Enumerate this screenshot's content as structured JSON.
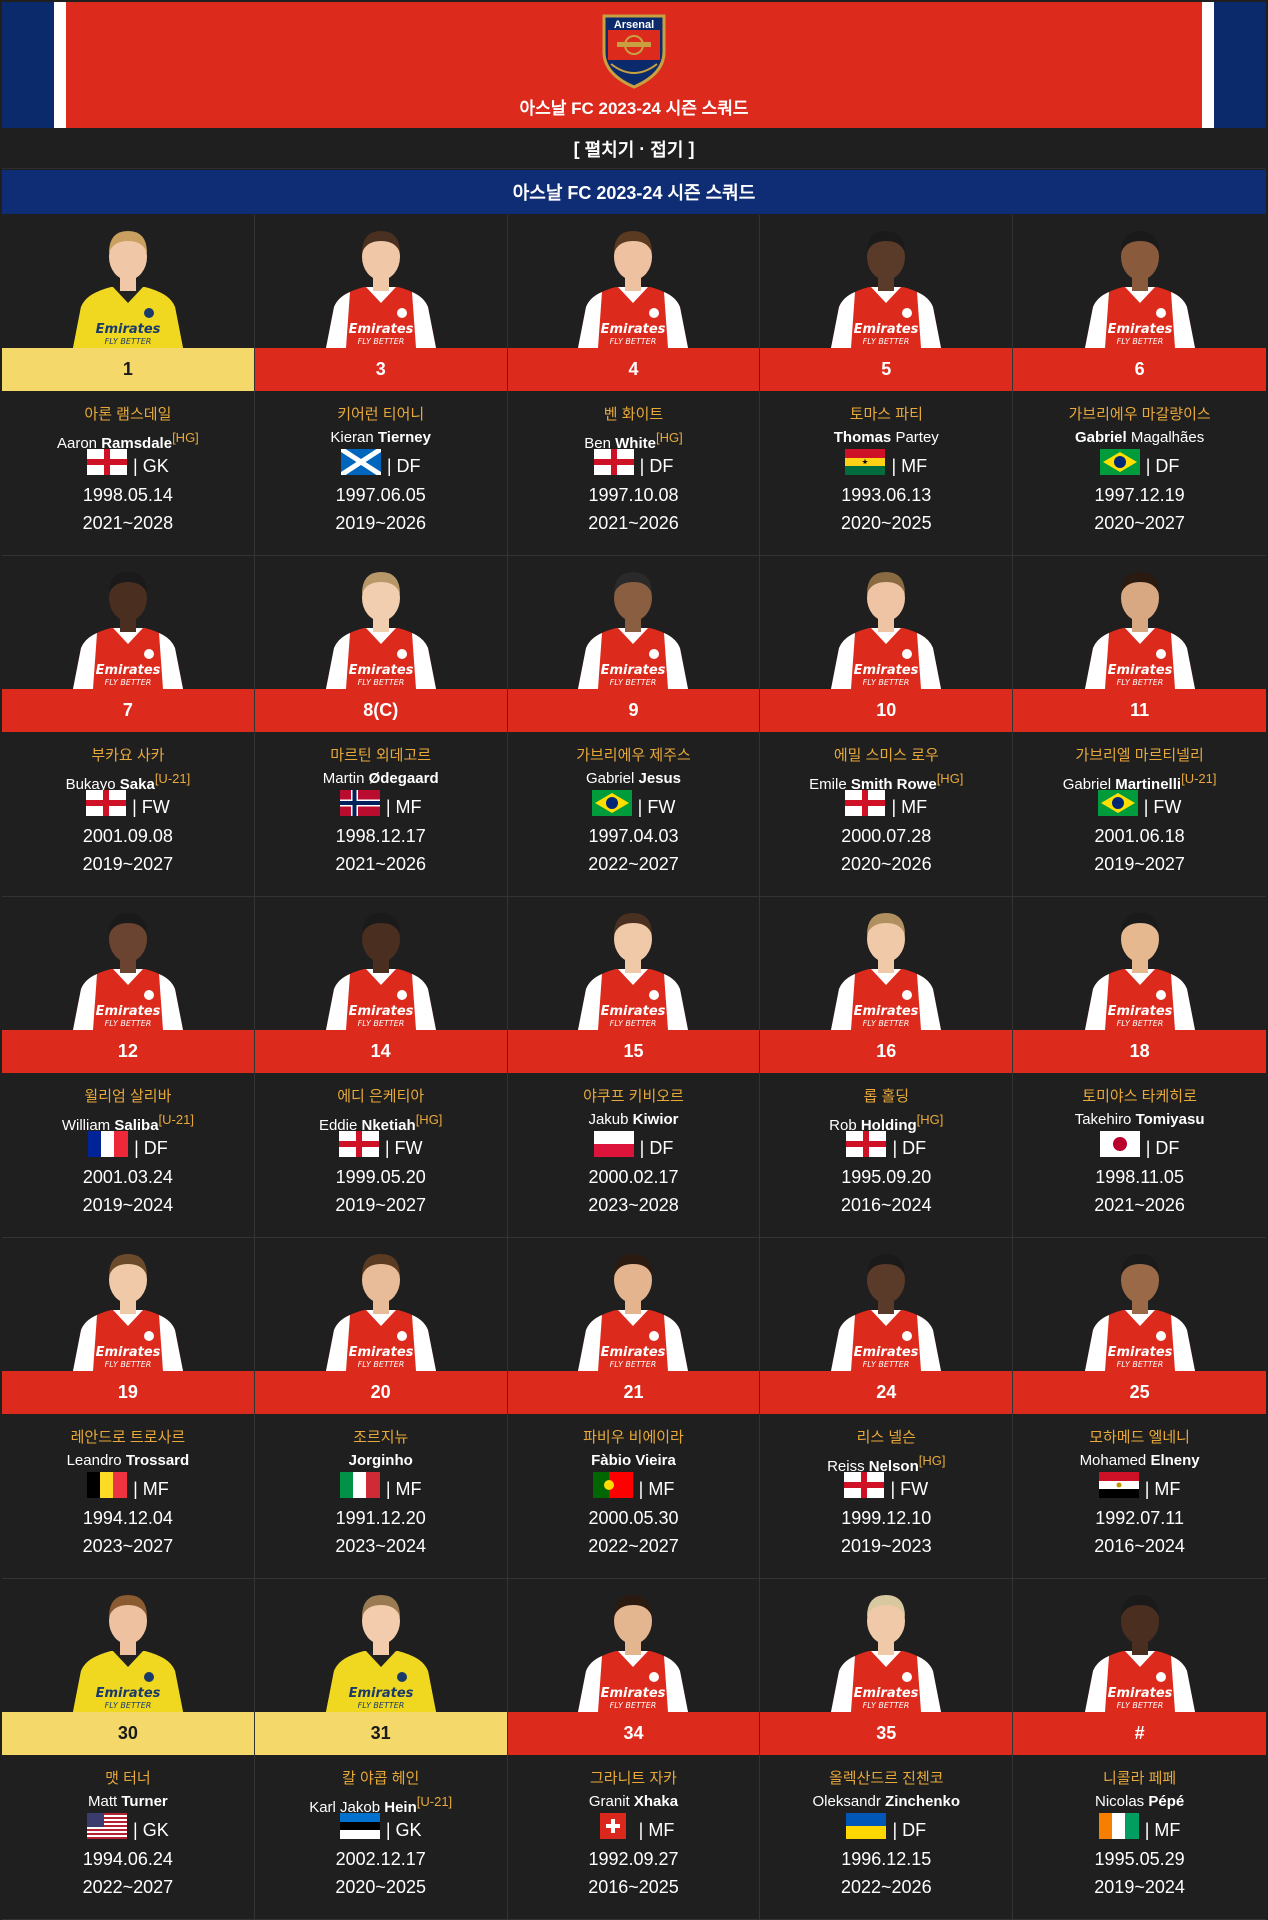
{
  "header": {
    "title": "아스날 FC 2023-24 시즌 스쿼드",
    "crest_text": "Arsenal"
  },
  "toggle": {
    "open_bracket": "[",
    "expand": "펼치기",
    "sep": "·",
    "collapse": "접기",
    "close_bracket": "]"
  },
  "section_title": "아스날 FC 2023-24 시즌 스쿼드",
  "colors": {
    "red": "#dc2a1c",
    "navy": "#0e2d75",
    "gold": "#e8a93a",
    "gk_bg": "#f4d96a",
    "bg": "#1f1f1f"
  },
  "players": [
    {
      "number": "1",
      "gk": true,
      "kname": "아론 램스데일",
      "first": "Aaron ",
      "last": "Ramsdale",
      "suffix": "[HG]",
      "flag": "england",
      "pos": "| GK",
      "dob": "1998.05.14",
      "contract": "2021~2028",
      "skin": "#f0c8a8",
      "hair": "#c9a060"
    },
    {
      "number": "3",
      "gk": false,
      "kname": "키어런 티어니",
      "first": "Kieran ",
      "last": "Tierney",
      "suffix": "",
      "flag": "scotland",
      "pos": "| DF",
      "dob": "1997.06.05",
      "contract": "2019~2026",
      "skin": "#f0c8a8",
      "hair": "#4a3020"
    },
    {
      "number": "4",
      "gk": false,
      "kname": "벤 화이트",
      "first": "Ben ",
      "last": "White",
      "suffix": "[HG]",
      "flag": "england",
      "pos": "| DF",
      "dob": "1997.10.08",
      "contract": "2021~2026",
      "skin": "#eec2a0",
      "hair": "#5a3a20"
    },
    {
      "number": "5",
      "gk": false,
      "kname": "토마스 파티",
      "first": "Thomas",
      "last": " Partey",
      "suffix": "",
      "boldfirst": true,
      "flag": "ghana",
      "pos": "| MF",
      "dob": "1993.06.13",
      "contract": "2020~2025",
      "skin": "#5a3a28",
      "hair": "#1a1a1a"
    },
    {
      "number": "6",
      "gk": false,
      "kname": "가브리에우 마갈량이스",
      "first": "Gabriel",
      "last": " Magalhães",
      "suffix": "",
      "boldfirst": true,
      "flag": "brazil",
      "pos": "| DF",
      "dob": "1997.12.19",
      "contract": "2020~2027",
      "skin": "#8a5a3c",
      "hair": "#1a1a1a"
    },
    {
      "number": "7",
      "gk": false,
      "kname": "부카요 사카",
      "first": "Bukayo ",
      "last": "Saka",
      "suffix": "[U-21]",
      "flag": "england",
      "pos": "| FW",
      "dob": "2001.09.08",
      "contract": "2019~2027",
      "skin": "#4a2e20",
      "hair": "#1a1a1a"
    },
    {
      "number": "8(C)",
      "gk": false,
      "kname": "마르틴 외데고르",
      "first": "Martin ",
      "last": "Ødegaard",
      "suffix": "",
      "flag": "norway",
      "pos": "| MF",
      "dob": "1998.12.17",
      "contract": "2021~2026",
      "skin": "#f2ceb0",
      "hair": "#b89868"
    },
    {
      "number": "9",
      "gk": false,
      "kname": "가브리에우 제주스",
      "first": "Gabriel ",
      "last": "Jesus",
      "suffix": "",
      "flag": "brazil",
      "pos": "| FW",
      "dob": "1997.04.03",
      "contract": "2022~2027",
      "skin": "#8a5e40",
      "hair": "#2a2a2a"
    },
    {
      "number": "10",
      "gk": false,
      "kname": "에밀 스미스 로우",
      "first": "Emile ",
      "last": "Smith Rowe",
      "suffix": "[HG]",
      "flag": "england",
      "pos": "| MF",
      "dob": "2000.07.28",
      "contract": "2020~2026",
      "skin": "#eec4a4",
      "hair": "#8a6a40"
    },
    {
      "number": "11",
      "gk": false,
      "kname": "가브리엘 마르티넬리",
      "first": "Gabriel ",
      "last": "Martinelli",
      "suffix": "[U-21]",
      "flag": "brazil",
      "pos": "| FW",
      "dob": "2001.06.18",
      "contract": "2019~2027",
      "skin": "#d8a882",
      "hair": "#2a1a10"
    },
    {
      "number": "12",
      "gk": false,
      "kname": "윌리엄 살리바",
      "first": "William ",
      "last": "Saliba",
      "suffix": "[U-21]",
      "flag": "france",
      "pos": "| DF",
      "dob": "2001.03.24",
      "contract": "2019~2024",
      "skin": "#6a4430",
      "hair": "#1a1a1a"
    },
    {
      "number": "14",
      "gk": false,
      "kname": "에디 은케티아",
      "first": "Eddie ",
      "last": "Nketiah",
      "suffix": "[HG]",
      "flag": "england",
      "pos": "| FW",
      "dob": "1999.05.20",
      "contract": "2019~2027",
      "skin": "#4a2e20",
      "hair": "#1a1a1a"
    },
    {
      "number": "15",
      "gk": false,
      "kname": "야쿠프 키비오르",
      "first": "Jakub ",
      "last": "Kiwior",
      "suffix": "",
      "flag": "poland",
      "pos": "| DF",
      "dob": "2000.02.17",
      "contract": "2023~2028",
      "skin": "#f0caa8",
      "hair": "#4a3020"
    },
    {
      "number": "16",
      "gk": false,
      "kname": "롭 홀딩",
      "first": "Rob ",
      "last": "Holding",
      "suffix": "[HG]",
      "flag": "england",
      "pos": "| DF",
      "dob": "1995.09.20",
      "contract": "2016~2024",
      "skin": "#f0caa8",
      "hair": "#b09060"
    },
    {
      "number": "18",
      "gk": false,
      "kname": "토미야스 타케히로",
      "first": "Takehiro ",
      "last": "Tomiyasu",
      "suffix": "",
      "flag": "japan",
      "pos": "| DF",
      "dob": "1998.11.05",
      "contract": "2021~2026",
      "skin": "#e6b890",
      "hair": "#1a1a1a"
    },
    {
      "number": "19",
      "gk": false,
      "kname": "레안드로 트로사르",
      "first": "Leandro ",
      "last": "Trossard",
      "suffix": "",
      "flag": "belgium",
      "pos": "| MF",
      "dob": "1994.12.04",
      "contract": "2023~2027",
      "skin": "#f0caa8",
      "hair": "#6a4a2a"
    },
    {
      "number": "20",
      "gk": false,
      "kname": "조르지뉴",
      "first": "",
      "last": "Jorginho",
      "suffix": "",
      "flag": "italy",
      "pos": "| MF",
      "dob": "1991.12.20",
      "contract": "2023~2024",
      "skin": "#e8bc98",
      "hair": "#5a3a20"
    },
    {
      "number": "21",
      "gk": false,
      "kname": "파비우 비에이라",
      "first": "",
      "last": "Fàbio Vieira",
      "suffix": "",
      "flag": "portugal",
      "pos": "| MF",
      "dob": "2000.05.30",
      "contract": "2022~2027",
      "skin": "#e4b48e",
      "hair": "#2a1a10"
    },
    {
      "number": "24",
      "gk": false,
      "kname": "리스 넬슨",
      "first": "Reiss ",
      "last": "Nelson",
      "suffix": "[HG]",
      "flag": "england",
      "pos": "| FW",
      "dob": "1999.12.10",
      "contract": "2019~2023",
      "skin": "#5a3a28",
      "hair": "#1a1a1a"
    },
    {
      "number": "25",
      "gk": false,
      "kname": "모하메드 엘네니",
      "first": "Mohamed ",
      "last": "Elneny",
      "suffix": "",
      "flag": "egypt",
      "pos": "| MF",
      "dob": "1992.07.11",
      "contract": "2016~2024",
      "skin": "#9a6a48",
      "hair": "#1a1a1a"
    },
    {
      "number": "30",
      "gk": true,
      "kname": "맷 터너",
      "first": "Matt ",
      "last": "Turner",
      "suffix": "",
      "flag": "usa",
      "pos": "| GK",
      "dob": "1994.06.24",
      "contract": "2022~2027",
      "skin": "#eec2a0",
      "hair": "#8a5a30"
    },
    {
      "number": "31",
      "gk": true,
      "kname": "칼 야콥 헤인",
      "first": "Karl Jakob ",
      "last": "Hein",
      "suffix": "[U-21]",
      "flag": "estonia",
      "pos": "| GK",
      "dob": "2002.12.17",
      "contract": "2020~2025",
      "skin": "#f2ccac",
      "hair": "#9a7a50"
    },
    {
      "number": "34",
      "gk": false,
      "kname": "그라니트 자카",
      "first": "Granit ",
      "last": "Xhaka",
      "suffix": "",
      "flag": "switzerland",
      "pos": "| MF",
      "dob": "1992.09.27",
      "contract": "2016~2025",
      "skin": "#e4b690",
      "hair": "#2a1a10"
    },
    {
      "number": "35",
      "gk": false,
      "kname": "올렉산드르 진첸코",
      "first": "Oleksandr ",
      "last": "Zinchenko",
      "suffix": "",
      "flag": "ukraine",
      "pos": "| DF",
      "dob": "1996.12.15",
      "contract": "2022~2026",
      "skin": "#f0caa8",
      "hair": "#d8c8a0"
    },
    {
      "number": "#",
      "gk": false,
      "kname": "니콜라 페페",
      "first": "Nicolas ",
      "last": "Pépé",
      "suffix": "",
      "flag": "ireland_like",
      "pos": "| MF",
      "dob": "1995.05.29",
      "contract": "2019~2024",
      "skin": "#4a2e20",
      "hair": "#1a1a1a"
    }
  ]
}
